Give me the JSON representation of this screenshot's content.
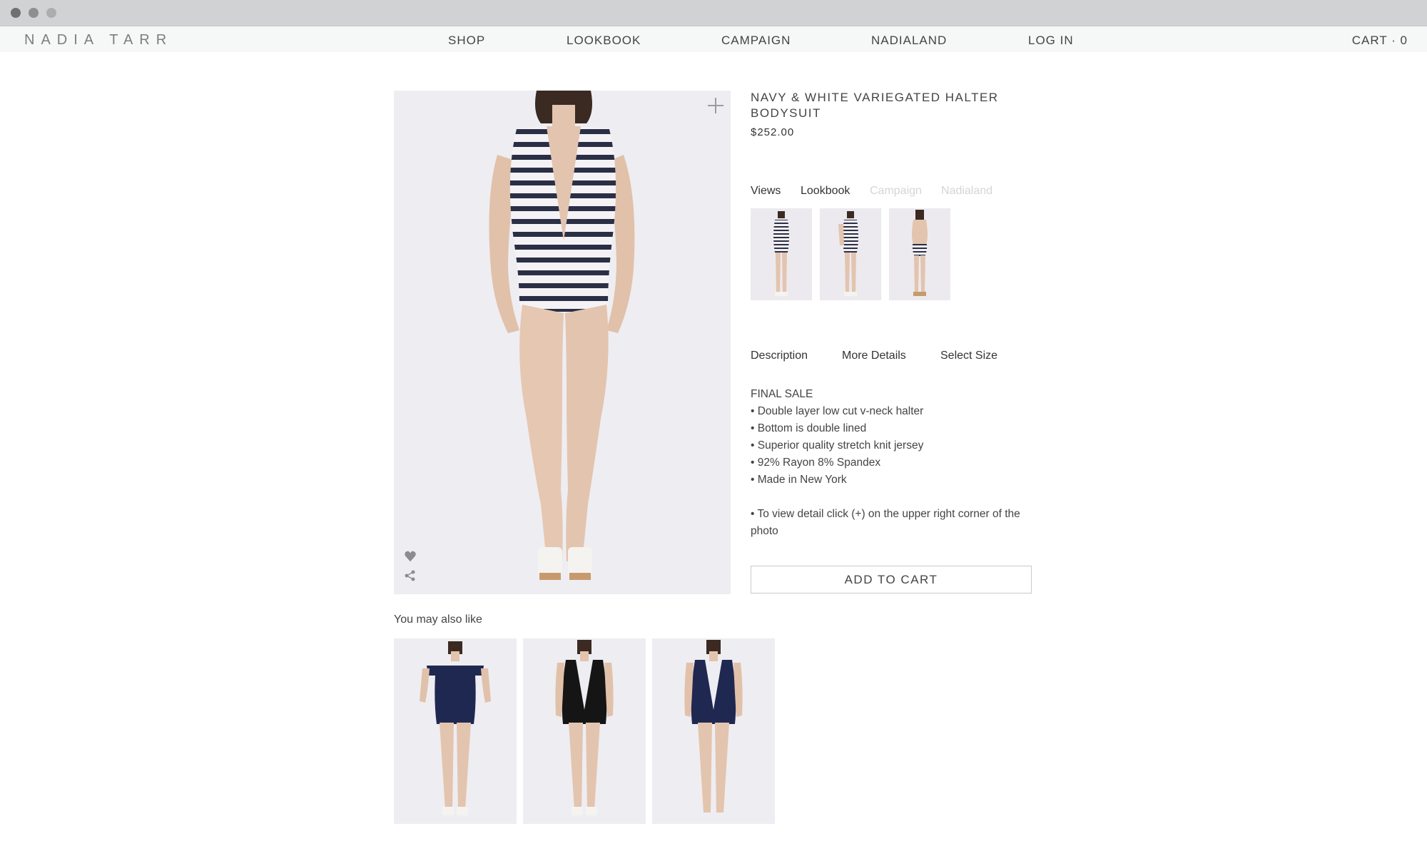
{
  "brand": {
    "logo": "NADIA TARR"
  },
  "nav": {
    "items": [
      {
        "label": "SHOP"
      },
      {
        "label": "LOOKBOOK"
      },
      {
        "label": "CAMPAIGN"
      },
      {
        "label": "NADIALAND"
      },
      {
        "label": "LOG IN"
      }
    ],
    "cart_label": "CART · 0"
  },
  "product": {
    "title": "NAVY & WHITE VARIEGATED HALTER BODYSUIT",
    "price": "$252.00",
    "media_tabs": [
      {
        "label": "Views",
        "active": true
      },
      {
        "label": "Lookbook",
        "active": true
      },
      {
        "label": "Campaign",
        "active": false
      },
      {
        "label": "Nadialand",
        "active": false
      }
    ],
    "info_tabs": [
      "Description",
      "More Details",
      "Select Size"
    ],
    "description": {
      "heading": "FINAL SALE",
      "bullets": [
        "• Double layer low cut v-neck halter",
        "• Bottom is double lined",
        "• Superior quality stretch knit jersey",
        "• 92% Rayon 8% Spandex",
        "• Made in New York"
      ],
      "note": "• To view detail click (+) on the upper right corner of the photo"
    },
    "add_to_cart": "ADD TO CART"
  },
  "recommendations": {
    "heading": "You may also like"
  },
  "colors": {
    "image_bg": "#eeedf2",
    "navy": "#1f2850",
    "black": "#151515",
    "skin": "#e3c4ae",
    "nav_bg": "#f6f7f7"
  }
}
